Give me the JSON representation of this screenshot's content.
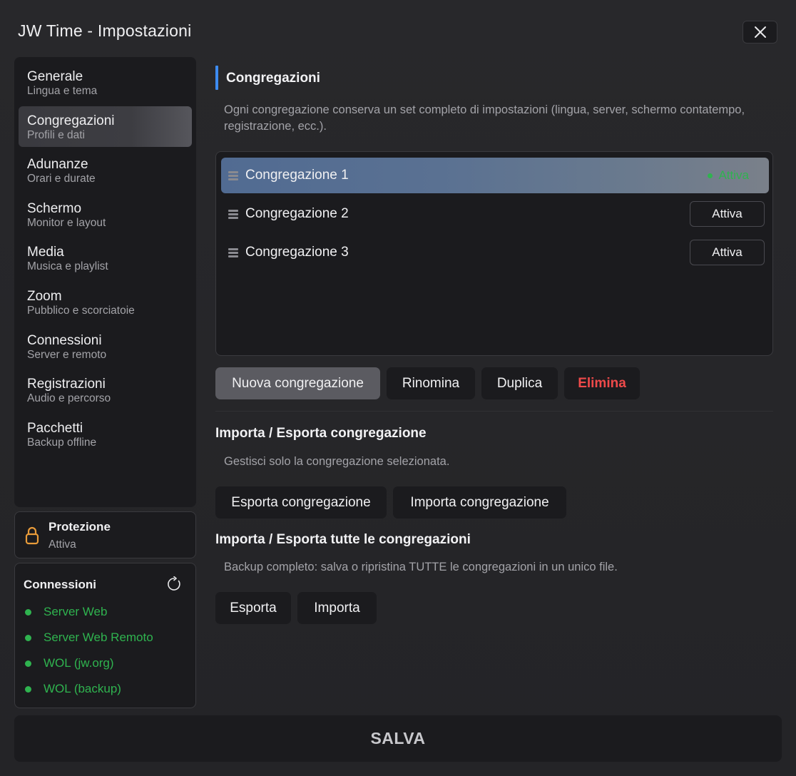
{
  "window": {
    "title": "JW Time - Impostazioni"
  },
  "sidebar": {
    "items": [
      {
        "label": "Generale",
        "sub": "Lingua e tema"
      },
      {
        "label": "Congregazioni",
        "sub": "Profili e dati",
        "active": true
      },
      {
        "label": "Adunanze",
        "sub": "Orari e durate"
      },
      {
        "label": "Schermo",
        "sub": "Monitor e layout"
      },
      {
        "label": "Media",
        "sub": "Musica e playlist"
      },
      {
        "label": "Zoom",
        "sub": "Pubblico e scorciatoie"
      },
      {
        "label": "Connessioni",
        "sub": "Server e remoto"
      },
      {
        "label": "Registrazioni",
        "sub": "Audio e percorso"
      },
      {
        "label": "Pacchetti",
        "sub": "Backup offline"
      }
    ]
  },
  "protection": {
    "title": "Protezione",
    "status": "Attiva",
    "icon": "lock-icon",
    "color": "#e89b3a"
  },
  "connections": {
    "title": "Connessioni",
    "items": [
      {
        "label": "Server Web"
      },
      {
        "label": "Server Web Remoto"
      },
      {
        "label": "WOL (jw.org)"
      },
      {
        "label": "WOL (backup)"
      }
    ],
    "status_color": "#2fb34f"
  },
  "main": {
    "title": "Congregazioni",
    "description": "Ogni congregazione conserva un set completo di impostazioni (lingua, server, schermo contatempo, registrazione, ecc.).",
    "congregations": [
      {
        "name": "Congregazione 1",
        "status": "Attiva",
        "active": true
      },
      {
        "name": "Congregazione 2",
        "button": "Attiva"
      },
      {
        "name": "Congregazione 3",
        "button": "Attiva"
      }
    ],
    "actions": {
      "new": "Nuova congregazione",
      "rename": "Rinomina",
      "duplicate": "Duplica",
      "delete": "Elimina"
    },
    "import_export_single": {
      "title": "Importa / Esporta congregazione",
      "description": "Gestisci solo la congregazione selezionata.",
      "export": "Esporta congregazione",
      "import": "Importa congregazione"
    },
    "import_export_all": {
      "title": "Importa / Esporta tutte le congregazioni",
      "description": "Backup completo: salva o ripristina TUTTE le congregazioni in un unico file.",
      "export": "Esporta",
      "import": "Importa"
    }
  },
  "footer": {
    "save": "SALVA"
  },
  "colors": {
    "accent": "#3d8bf0",
    "danger": "#ef4a4a",
    "success": "#2fb34f"
  }
}
